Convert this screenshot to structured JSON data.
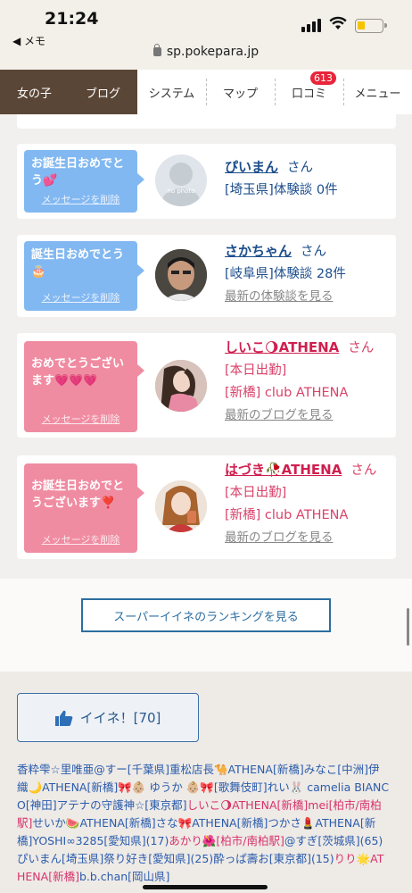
{
  "status": {
    "time": "21:24",
    "back_app": "◀ メモ"
  },
  "browser": {
    "url": "sp.pokepara.jp"
  },
  "nav": [
    {
      "label": "女の子"
    },
    {
      "label": "ブログ"
    },
    {
      "label": "システム"
    },
    {
      "label": "マップ"
    },
    {
      "label": "口コミ",
      "badge": "613"
    },
    {
      "label": "メニュー"
    }
  ],
  "cards": [
    {
      "bubble": "お誕生日おめでとう💕",
      "bubble_color": "#82b8f1",
      "delete_label": "メッセージを削除",
      "name": "ぴいまん",
      "honorific": "さん",
      "lines": [
        "[埼玉県]体験談 0件"
      ],
      "link": "",
      "avatar": "no photo"
    },
    {
      "bubble": "誕生日おめでとう🎂",
      "bubble_color": "#82b8f1",
      "delete_label": "メッセージを削除",
      "name": "さかちゃん",
      "honorific": "さん",
      "lines": [
        "[岐阜県]体験談 28件"
      ],
      "link": "最新の体験談を見る"
    },
    {
      "bubble": "おめでとうございます💗💗💗",
      "bubble_color": "#f08ca2",
      "delete_label": "メッセージを削除",
      "name": "しいこ🌖ATHENA",
      "honorific": "さん",
      "lines": [
        "[本日出勤]",
        "[新橋] club ATHENA"
      ],
      "link": "最新のブログを見る"
    },
    {
      "bubble": "お誕生日おめでとうございます❣️",
      "bubble_color": "#f08ca2",
      "delete_label": "メッセージを削除",
      "name": "はづき🥀ATHENA",
      "honorific": "さん",
      "lines": [
        "[本日出勤]",
        "[新橋] club ATHENA"
      ],
      "link": "最新のブログを見る"
    }
  ],
  "ranking_button": "スーパーイイネのランキングを見る",
  "like_button": "イイネ！[70]",
  "likers": [
    {
      "t": "香粋雫☆里唯亜@すー[千葉県]",
      "pink": false
    },
    {
      "t": "重松店長🐪",
      "pink": false
    },
    {
      "t": "ATHENA[新橋]みなこ[中洲]",
      "pink": false
    },
    {
      "t": "伊織🌙ATHENA[新橋]🎀👶🏼 ゆうか 👶🏼🎀[歌舞伎町]",
      "pink": false
    },
    {
      "t": "れい🐰 camelia BIANCO[神田]",
      "pink": false
    },
    {
      "t": "アテナの守護神☆[東京都]",
      "pink": false
    },
    {
      "t": "しいこ🌖ATHENA[新橋]mei[柏市/南柏駅]",
      "pink": true
    },
    {
      "t": "せいか🍉ATHENA[新橋]",
      "pink": false
    },
    {
      "t": "さな🎀ATHENA[新橋]つかさ💄ATHENA[新橋]",
      "pink": false
    },
    {
      "t": "YOSHI∞3285[愛知県](17)",
      "pink": false
    },
    {
      "t": "あかり🌺[柏市/南柏駅]",
      "pink": true
    },
    {
      "t": "@すぎ[茨城県](65)",
      "pink": false
    },
    {
      "t": "ぴいまん[埼玉県]",
      "pink": false
    },
    {
      "t": "祭り好き[愛知県](25)",
      "pink": false
    },
    {
      "t": "酔っぱ壽お[東京都](15)",
      "pink": false
    },
    {
      "t": "りり🌟ATHENA[新橋]",
      "pink": true
    },
    {
      "t": "b.b.chan[岡山県]",
      "pink": false
    }
  ]
}
